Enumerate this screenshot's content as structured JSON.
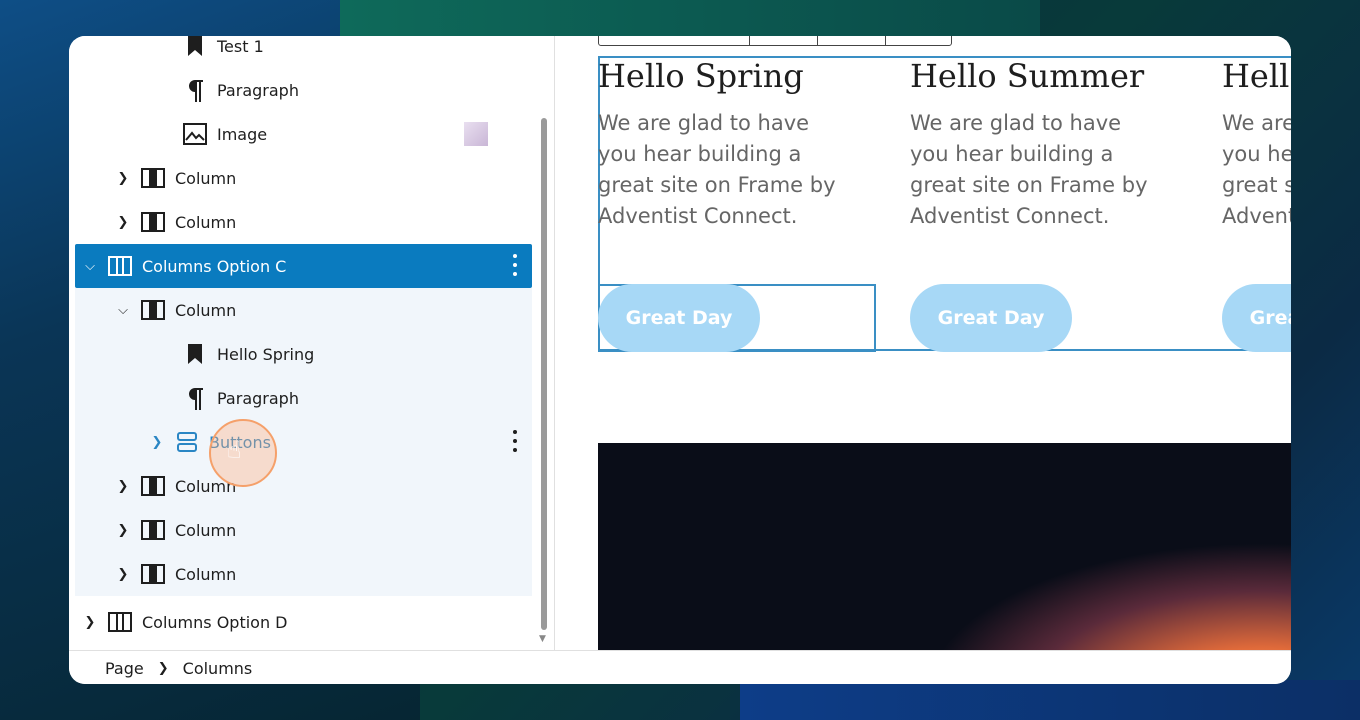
{
  "list_view": {
    "items": [
      {
        "label": "Test 1",
        "icon": "bookmark-icon"
      },
      {
        "label": "Paragraph",
        "icon": "paragraph-icon"
      },
      {
        "label": "Image",
        "icon": "image-icon"
      },
      {
        "label": "Column",
        "icon": "column-icon"
      },
      {
        "label": "Column",
        "icon": "column-icon"
      },
      {
        "label": "Columns Option C",
        "icon": "columns-icon"
      },
      {
        "label": "Column",
        "icon": "column-icon"
      },
      {
        "label": "Hello Spring",
        "icon": "bookmark-icon"
      },
      {
        "label": "Paragraph",
        "icon": "paragraph-icon"
      },
      {
        "label": "Buttons",
        "icon": "buttons-icon"
      },
      {
        "label": "Column",
        "icon": "column-icon"
      },
      {
        "label": "Column",
        "icon": "column-icon"
      },
      {
        "label": "Column",
        "icon": "column-icon"
      },
      {
        "label": "Columns Option D",
        "icon": "columns-icon"
      }
    ]
  },
  "breadcrumb": {
    "page": "Page",
    "current": "Columns"
  },
  "canvas": {
    "columns": [
      {
        "title": "Hello Spring",
        "text": "We are glad to have you hear building a great site on Frame by Adventist Connect.",
        "button": "Great Day"
      },
      {
        "title": "Hello Summer",
        "text": "We are glad to have you hear building a great site on Frame by Adventist Connect.",
        "button": "Great Day"
      },
      {
        "title": "Hello",
        "text": "We are glad to have you hear building a great site on Frame by Adventist Connect.",
        "button": "Great Day"
      }
    ]
  },
  "colors": {
    "selected": "#0a7bbf",
    "button": "#a7d8f6",
    "outline": "#3a8fc4"
  }
}
